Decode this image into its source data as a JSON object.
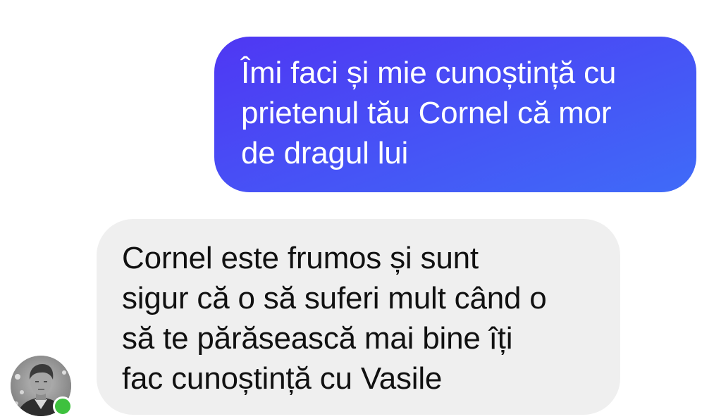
{
  "colors": {
    "outgoing_bubble_start": "#4f37f3",
    "outgoing_bubble_end": "#3f6bf8",
    "incoming_bubble": "#efefef",
    "presence_online": "#3ec13e"
  },
  "conversation": {
    "outgoing_message": {
      "lines": [
        "Îmi faci și mie cunoștință cu",
        "prietenul tău Cornel că mor",
        "de dragul lui"
      ]
    },
    "incoming_message": {
      "lines": [
        "Cornel este frumos și sunt",
        "sigur că o să suferi mult când o",
        "să te părăsească mai bine îți",
        "fac cunoștință cu Vasile"
      ]
    },
    "contact": {
      "avatar_icon": "person-photo-icon",
      "status": "online"
    }
  }
}
